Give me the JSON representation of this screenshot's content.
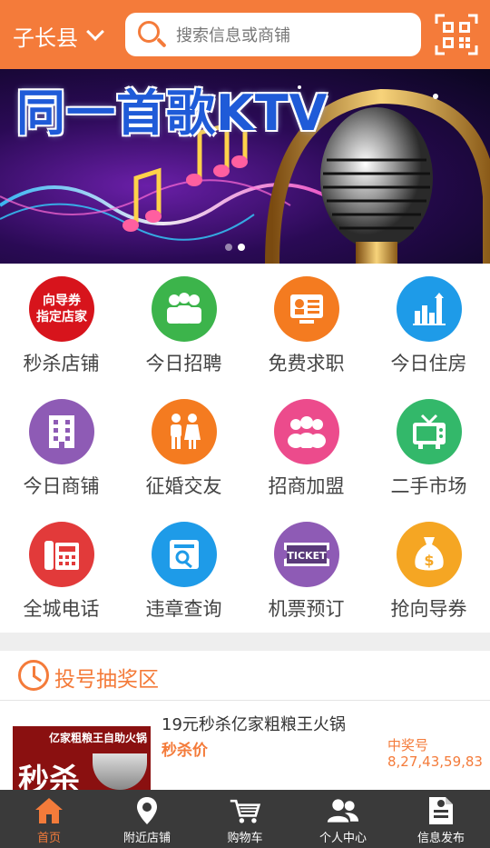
{
  "header": {
    "city": "子长县",
    "search_placeholder": "搜索信息或商铺"
  },
  "banner": {
    "title": "同一首歌KTV",
    "slide_count": 2,
    "active_slide": 1
  },
  "categories": [
    {
      "label": "秒杀店铺",
      "icon": "voucher-store-icon",
      "color": "#d7141c",
      "badge": [
        "向导券",
        "指定店家"
      ]
    },
    {
      "label": "今日招聘",
      "icon": "people-group-icon",
      "color": "#3cb44b"
    },
    {
      "label": "免费求职",
      "icon": "resume-icon",
      "color": "#f47b20"
    },
    {
      "label": "今日住房",
      "icon": "buildings-icon",
      "color": "#1e9be8"
    },
    {
      "label": "今日商铺",
      "icon": "office-building-icon",
      "color": "#8e5bb5"
    },
    {
      "label": "征婚交友",
      "icon": "couple-icon",
      "color": "#f47b20"
    },
    {
      "label": "招商加盟",
      "icon": "team-icon",
      "color": "#ec4b8c"
    },
    {
      "label": "二手市场",
      "icon": "tv-icon",
      "color": "#33b86a"
    },
    {
      "label": "全城电话",
      "icon": "telephone-icon",
      "color": "#e23a3a"
    },
    {
      "label": "违章查询",
      "icon": "document-search-icon",
      "color": "#1e9be8"
    },
    {
      "label": "机票预订",
      "icon": "ticket-icon",
      "color": "#8e5bb5",
      "ticket_text": "TICKET"
    },
    {
      "label": "抢向导券",
      "icon": "money-bag-icon",
      "color": "#f5a623"
    }
  ],
  "lottery": {
    "title": "投号抽奖区",
    "deal": {
      "name": "19元秒杀亿家粗粮王火锅",
      "price_label": "秒杀价",
      "win_label": "中奖号",
      "win_numbers": "8,27,43,59,83",
      "thumb_title": "亿家粗粮王自助火锅",
      "thumb_text": "秒杀"
    }
  },
  "tabs": [
    {
      "label": "首页",
      "icon": "home-icon",
      "active": true
    },
    {
      "label": "附近店铺",
      "icon": "location-pin-icon",
      "active": false
    },
    {
      "label": "购物车",
      "icon": "cart-icon",
      "active": false
    },
    {
      "label": "个人中心",
      "icon": "user-icon",
      "active": false
    },
    {
      "label": "信息发布",
      "icon": "publish-icon",
      "active": false
    }
  ],
  "colors": {
    "accent": "#f47b3a",
    "tabbar": "#3a3a3a"
  }
}
